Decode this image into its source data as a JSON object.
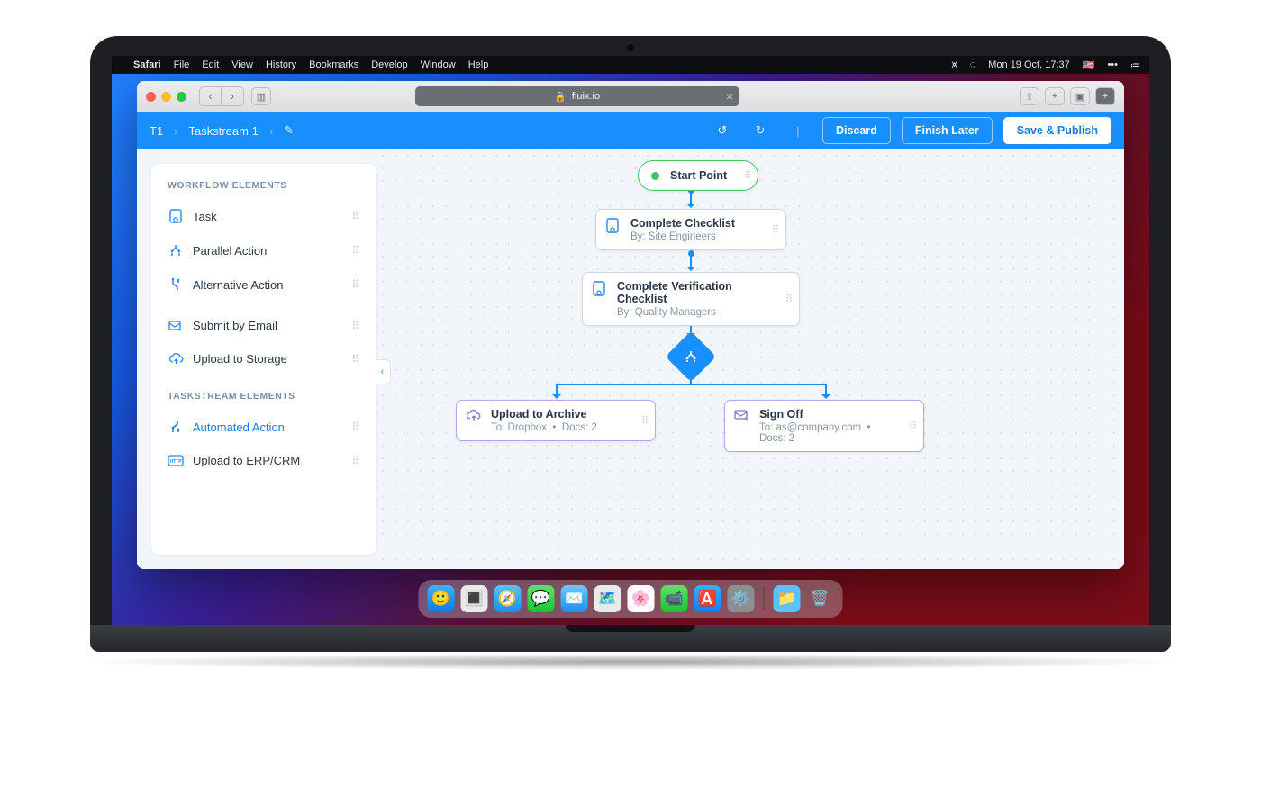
{
  "menubar": {
    "app": "Safari",
    "items": [
      "File",
      "Edit",
      "View",
      "History",
      "Bookmarks",
      "Develop",
      "Window",
      "Help"
    ],
    "clock": "Mon 19 Oct, 17:37"
  },
  "browser": {
    "url_lock": "🔒",
    "url": "fluix.io"
  },
  "header": {
    "code": "T1",
    "name": "Taskstream 1",
    "discard": "Discard",
    "finish": "Finish Later",
    "save": "Save & Publish"
  },
  "sidebar": {
    "sect1": "WORKFLOW ELEMENTS",
    "elements": [
      {
        "label": "Task"
      },
      {
        "label": "Parallel Action"
      },
      {
        "label": "Alternative Action"
      },
      {
        "label": "Submit by Email"
      },
      {
        "label": "Upload to Storage"
      }
    ],
    "sect2": "TASKSTREAM ELEMENTS",
    "ts_elements": [
      {
        "label": "Automated Action"
      },
      {
        "label": "Upload to ERP/CRM"
      }
    ]
  },
  "flow": {
    "start": "Start Point",
    "n1": {
      "title": "Complete Checklist",
      "sub": "By: Site Engineers"
    },
    "n2": {
      "title": "Complete Verification Checklist",
      "sub": "By: Quality Managers"
    },
    "n3": {
      "title": "Upload to Archive",
      "sub_a": "To: Dropbox",
      "sub_b": "Docs: 2"
    },
    "n4": {
      "title": "Sign Off",
      "sub_a": "To: as@company.com",
      "sub_b": "Docs: 2"
    }
  }
}
